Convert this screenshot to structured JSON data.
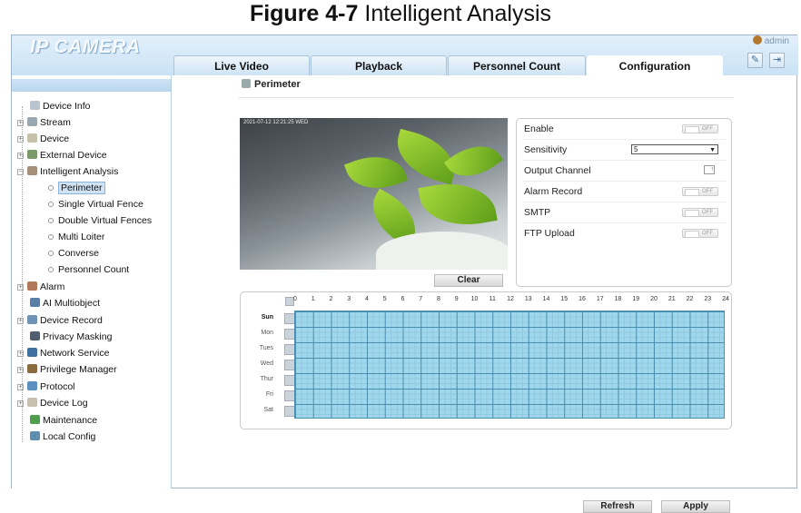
{
  "figure": {
    "label": "Figure 4-7",
    "title": " Intelligent Analysis"
  },
  "app": {
    "logo": "IP CAMERA",
    "user": "admin"
  },
  "tabs": [
    {
      "label": "Live Video"
    },
    {
      "label": "Playback"
    },
    {
      "label": "Personnel Count"
    },
    {
      "label": "Configuration",
      "active": true
    }
  ],
  "header_icons": [
    "edit-icon",
    "logout-icon"
  ],
  "sidebar": {
    "items": [
      {
        "label": "Device Info",
        "icon": "info-icon"
      },
      {
        "label": "Stream",
        "icon": "stream-icon"
      },
      {
        "label": "Device",
        "icon": "device-icon"
      },
      {
        "label": "External Device",
        "icon": "external-device-icon"
      },
      {
        "label": "Intelligent Analysis",
        "icon": "analysis-icon"
      },
      {
        "label": "Perimeter",
        "selected": true
      },
      {
        "label": "Single Virtual Fence"
      },
      {
        "label": "Double Virtual Fences"
      },
      {
        "label": "Multi Loiter"
      },
      {
        "label": "Converse"
      },
      {
        "label": "Personnel Count"
      },
      {
        "label": "Alarm",
        "icon": "alarm-icon"
      },
      {
        "label": "AI Multiobject",
        "icon": "ai-icon"
      },
      {
        "label": "Device Record",
        "icon": "record-icon"
      },
      {
        "label": "Privacy Masking",
        "icon": "privacy-icon"
      },
      {
        "label": "Network Service",
        "icon": "network-icon"
      },
      {
        "label": "Privilege Manager",
        "icon": "privilege-icon"
      },
      {
        "label": "Protocol",
        "icon": "protocol-icon"
      },
      {
        "label": "Device Log",
        "icon": "log-icon"
      },
      {
        "label": "Maintenance",
        "icon": "maintenance-icon"
      },
      {
        "label": "Local Config",
        "icon": "local-config-icon"
      }
    ]
  },
  "main": {
    "title": "Perimeter",
    "video_timestamp": "2021-07-12 12:21:25 WED",
    "clear_label": "Clear",
    "settings": {
      "enable": "Enable",
      "sensitivity": "Sensitivity",
      "sensitivity_value": "5",
      "output_channel": "Output Channel",
      "alarm_record": "Alarm Record",
      "smtp": "SMTP",
      "ftp_upload": "FTP Upload",
      "toggle_text": "OFF"
    },
    "schedule": {
      "hours": [
        "0",
        "1",
        "2",
        "3",
        "4",
        "5",
        "6",
        "7",
        "8",
        "9",
        "10",
        "11",
        "12",
        "13",
        "14",
        "15",
        "16",
        "17",
        "18",
        "19",
        "20",
        "21",
        "22",
        "23",
        "24"
      ],
      "days": [
        "Sun",
        "Mon",
        "Tues",
        "Wed",
        "Thur",
        "Fri",
        "Sat"
      ]
    },
    "refresh_label": "Refresh",
    "apply_label": "Apply"
  },
  "colors": {
    "grid_fill": "#9fd8ec",
    "grid_line": "#4b8fb0",
    "header_bg": "#c9e2f5"
  }
}
